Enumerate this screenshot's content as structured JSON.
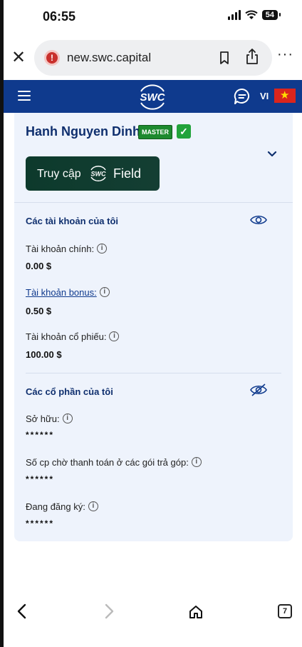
{
  "status": {
    "time": "06:55",
    "battery": "54"
  },
  "browser": {
    "url": "new.swc.capital",
    "close": "✕",
    "more": "···",
    "tab_count": "7"
  },
  "header": {
    "logo": "SWC",
    "lang": "VI"
  },
  "profile": {
    "name": "Hanh Nguyen Dinh",
    "badge": "MASTER",
    "verified": "✓"
  },
  "field_button": {
    "prefix": "Truy cập",
    "brand": "SWC",
    "label": "Field"
  },
  "accounts": {
    "title": "Các tài khoản của tôi",
    "items": [
      {
        "label": "Tài khoản chính:",
        "value": "0.00 $"
      },
      {
        "label": "Tài khoản bonus:",
        "value": "0.50 $"
      },
      {
        "label": "Tài khoản cổ phiếu:",
        "value": "100.00 $"
      }
    ]
  },
  "shares": {
    "title": "Các cổ phần của tôi",
    "items": [
      {
        "label": "Sở hữu:",
        "value": "******"
      },
      {
        "label": "Số cp chờ thanh toán ở các gói trả góp:",
        "value": "******"
      },
      {
        "label": "Đang đăng ký:",
        "value": "******"
      }
    ]
  },
  "colors": {
    "header_bg": "#0f3a8d",
    "card_bg": "#eef3fc",
    "title_text": "#0f2f6e",
    "field_btn": "#0d3a2c",
    "badge_green": "#1d8a2f"
  }
}
